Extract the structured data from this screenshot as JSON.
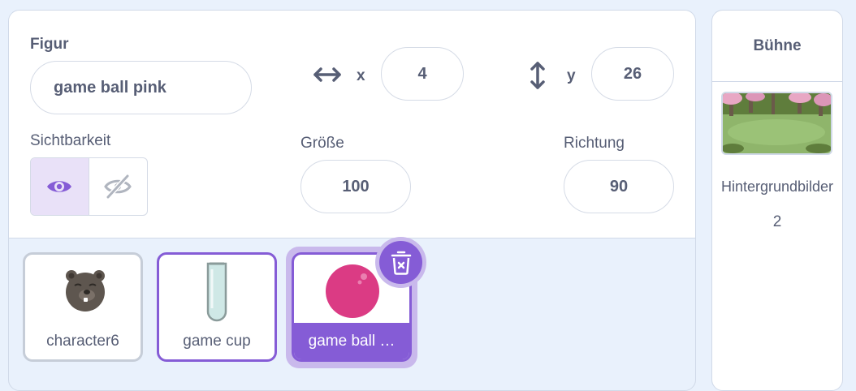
{
  "sprite_info": {
    "sprite_label": "Figur",
    "sprite_name": "game ball pink",
    "x_label": "x",
    "x_value": "4",
    "y_label": "y",
    "y_value": "26",
    "visibility_label": "Sichtbarkeit",
    "size_label": "Größe",
    "size_value": "100",
    "direction_label": "Richtung",
    "direction_value": "90"
  },
  "sprites": [
    {
      "name": "character6",
      "selected": false
    },
    {
      "name": "game cup",
      "selected": false
    },
    {
      "name": "game ball …",
      "selected": true
    }
  ],
  "stage": {
    "title": "Bühne",
    "backdrops_label": "Hintergrundbilder",
    "backdrops_count": "2"
  },
  "colors": {
    "accent": "#855cd6",
    "ball": "#db3b84",
    "text": "#575e75",
    "background": "#e9f1fc"
  },
  "icons": [
    "horizontal-arrow-icon",
    "vertical-arrow-icon",
    "eye-icon",
    "eye-slash-icon",
    "trash-icon"
  ]
}
